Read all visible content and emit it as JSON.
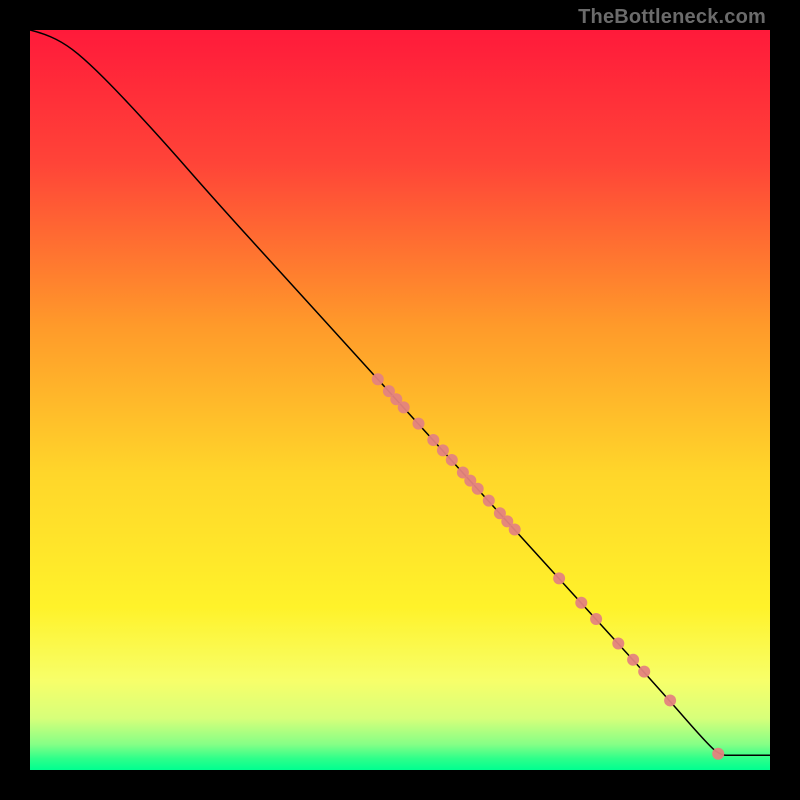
{
  "watermark": "TheBottleneck.com",
  "chart_data": {
    "type": "line",
    "title": "",
    "xlabel": "",
    "ylabel": "",
    "xlim": [
      0,
      100
    ],
    "ylim": [
      0,
      100
    ],
    "grid": false,
    "legend": false,
    "gradient_stops": [
      {
        "offset": 0.0,
        "color": "#ff1a3a"
      },
      {
        "offset": 0.18,
        "color": "#ff4438"
      },
      {
        "offset": 0.4,
        "color": "#ff9a2a"
      },
      {
        "offset": 0.6,
        "color": "#ffd62a"
      },
      {
        "offset": 0.78,
        "color": "#fff22a"
      },
      {
        "offset": 0.88,
        "color": "#f7ff6a"
      },
      {
        "offset": 0.93,
        "color": "#d7ff7a"
      },
      {
        "offset": 0.965,
        "color": "#86ff86"
      },
      {
        "offset": 0.985,
        "color": "#2cff8a"
      },
      {
        "offset": 1.0,
        "color": "#00ff90"
      }
    ],
    "series": [
      {
        "name": "curve",
        "type": "line",
        "color": "#000000",
        "width": 1.5,
        "points": [
          {
            "x": 0.0,
            "y": 100.0
          },
          {
            "x": 2.0,
            "y": 99.5
          },
          {
            "x": 5.0,
            "y": 98.0
          },
          {
            "x": 8.0,
            "y": 95.5
          },
          {
            "x": 12.0,
            "y": 91.5
          },
          {
            "x": 18.0,
            "y": 85.0
          },
          {
            "x": 25.0,
            "y": 77.0
          },
          {
            "x": 35.0,
            "y": 66.0
          },
          {
            "x": 45.0,
            "y": 55.0
          },
          {
            "x": 55.0,
            "y": 44.0
          },
          {
            "x": 65.0,
            "y": 33.0
          },
          {
            "x": 75.0,
            "y": 22.0
          },
          {
            "x": 85.0,
            "y": 11.0
          },
          {
            "x": 92.0,
            "y": 3.0
          },
          {
            "x": 93.5,
            "y": 2.0
          },
          {
            "x": 94.5,
            "y": 2.0
          },
          {
            "x": 100.0,
            "y": 2.0
          }
        ]
      },
      {
        "name": "points",
        "type": "scatter",
        "color": "#e4837e",
        "radius": 6,
        "points": [
          {
            "x": 47.0,
            "y": 52.8
          },
          {
            "x": 48.5,
            "y": 51.2
          },
          {
            "x": 49.5,
            "y": 50.1
          },
          {
            "x": 50.5,
            "y": 49.0
          },
          {
            "x": 52.5,
            "y": 46.8
          },
          {
            "x": 54.5,
            "y": 44.6
          },
          {
            "x": 55.8,
            "y": 43.2
          },
          {
            "x": 57.0,
            "y": 41.9
          },
          {
            "x": 58.5,
            "y": 40.2
          },
          {
            "x": 59.5,
            "y": 39.1
          },
          {
            "x": 60.5,
            "y": 38.0
          },
          {
            "x": 62.0,
            "y": 36.4
          },
          {
            "x": 63.5,
            "y": 34.7
          },
          {
            "x": 64.5,
            "y": 33.6
          },
          {
            "x": 65.5,
            "y": 32.5
          },
          {
            "x": 71.5,
            "y": 25.9
          },
          {
            "x": 74.5,
            "y": 22.6
          },
          {
            "x": 76.5,
            "y": 20.4
          },
          {
            "x": 79.5,
            "y": 17.1
          },
          {
            "x": 81.5,
            "y": 14.9
          },
          {
            "x": 83.0,
            "y": 13.3
          },
          {
            "x": 86.5,
            "y": 9.4
          },
          {
            "x": 93.0,
            "y": 2.2
          }
        ]
      }
    ]
  }
}
